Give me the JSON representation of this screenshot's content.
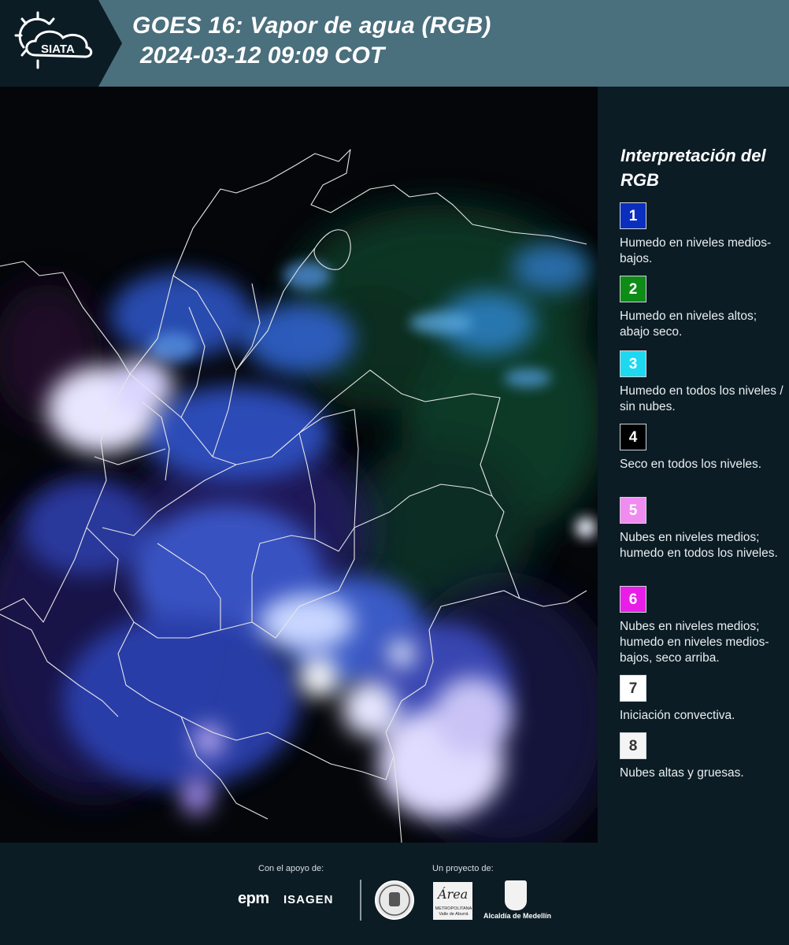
{
  "header": {
    "logo_text": "SIATA",
    "title": "GOES 16: Vapor de agua (RGB)",
    "timestamp": "2024-03-12 09:09 COT"
  },
  "legend": {
    "title": "Interpretación del RGB",
    "items": [
      {
        "number": "1",
        "color": "#0a2fbf",
        "text_color": "#ffffff",
        "description": "Humedo en niveles medios-bajos."
      },
      {
        "number": "2",
        "color": "#0e8c17",
        "text_color": "#ffffff",
        "description": "Humedo en niveles altos; abajo seco."
      },
      {
        "number": "3",
        "color": "#1ed8f0",
        "text_color": "#ffffff",
        "description": "Humedo en todos los niveles / sin nubes."
      },
      {
        "number": "4",
        "color": "#000000",
        "text_color": "#ffffff",
        "description": "Seco en todos los niveles."
      },
      {
        "number": "5",
        "color": "#f08cf0",
        "text_color": "#ffffff",
        "description": "Nubes en niveles medios; humedo en todos los niveles."
      },
      {
        "number": "6",
        "color": "#e81ee8",
        "text_color": "#ffffff",
        "description": "Nubes en niveles medios; humedo en niveles medios-bajos, seco arriba."
      },
      {
        "number": "7",
        "color": "#ffffff",
        "text_color": "#333333",
        "description": "Iniciación convectiva."
      },
      {
        "number": "8",
        "color": "#f4f4f4",
        "text_color": "#333333",
        "description": "Nubes altas y gruesas."
      }
    ]
  },
  "footer": {
    "support_label": "Con el apoyo de:",
    "project_label": "Un proyecto de:",
    "epm_logo": "epm",
    "isagen_logo": "ISAGEN",
    "area_logo": "Área",
    "area_sub": "METROPOLITANA Valle de Aburrá",
    "alcaldia_logo": "Alcaldía de Medellín"
  }
}
